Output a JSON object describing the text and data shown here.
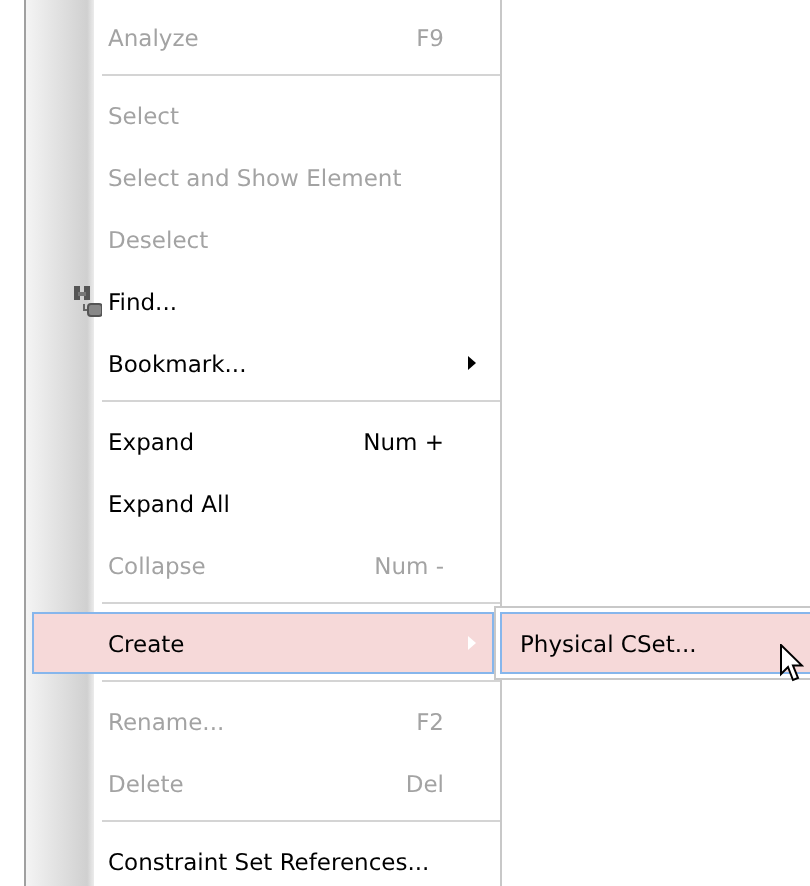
{
  "menu": {
    "entries": [
      {
        "kind": "item",
        "label": "Analyze",
        "shortcut": "F9",
        "disabled": true,
        "selected": false
      },
      {
        "kind": "separator"
      },
      {
        "kind": "item",
        "label": "Select",
        "disabled": true,
        "selected": false
      },
      {
        "kind": "item",
        "label": "Select and Show Element",
        "disabled": true,
        "selected": false
      },
      {
        "kind": "item",
        "label": "Deselect",
        "disabled": true,
        "selected": false
      },
      {
        "kind": "item",
        "label": "Find...",
        "icon": true,
        "disabled": false,
        "selected": false
      },
      {
        "kind": "item",
        "label": "Bookmark...",
        "submenu": true,
        "disabled": false,
        "selected": false
      },
      {
        "kind": "separator"
      },
      {
        "kind": "item",
        "label": "Expand",
        "shortcut": "Num +",
        "disabled": false,
        "selected": false
      },
      {
        "kind": "item",
        "label": "Expand All",
        "disabled": false,
        "selected": false
      },
      {
        "kind": "item",
        "label": "Collapse",
        "shortcut": "Num -",
        "disabled": true,
        "selected": false
      },
      {
        "kind": "separator"
      },
      {
        "kind": "item",
        "label": "Create",
        "submenu": true,
        "disabled": false,
        "selected": true
      },
      {
        "kind": "separator"
      },
      {
        "kind": "item",
        "label": "Rename...",
        "shortcut": "F2",
        "disabled": true,
        "selected": false
      },
      {
        "kind": "item",
        "label": "Delete",
        "shortcut": "Del",
        "disabled": true,
        "selected": false
      },
      {
        "kind": "separator"
      },
      {
        "kind": "item",
        "label": "Constraint Set References...",
        "disabled": false,
        "selected": false
      }
    ]
  },
  "submenu": {
    "items": [
      {
        "label": "Physical CSet...",
        "selected": true
      }
    ]
  }
}
